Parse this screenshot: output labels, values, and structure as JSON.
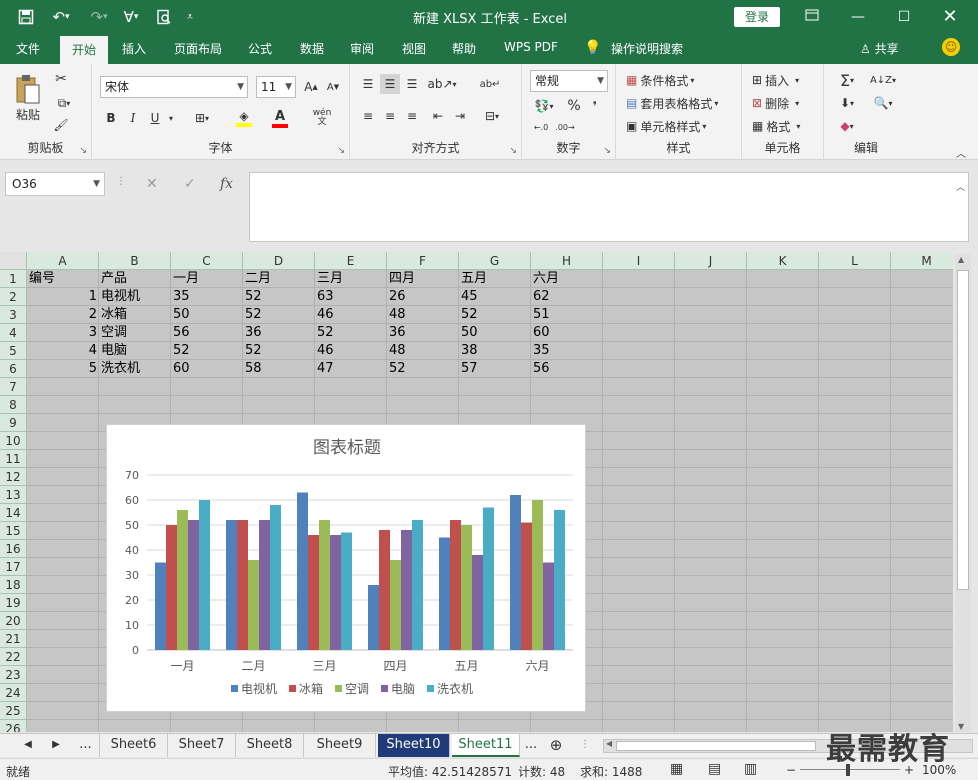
{
  "window": {
    "title": "新建 XLSX 工作表 - Excel",
    "login": "登录"
  },
  "tabs": [
    {
      "label": "文件"
    },
    {
      "label": "开始"
    },
    {
      "label": "插入"
    },
    {
      "label": "页面布局"
    },
    {
      "label": "公式"
    },
    {
      "label": "数据"
    },
    {
      "label": "审阅"
    },
    {
      "label": "视图"
    },
    {
      "label": "帮助"
    },
    {
      "label": "WPS PDF"
    },
    {
      "label": "操作说明搜索"
    }
  ],
  "share": "共享",
  "ribbon": {
    "clipboard": {
      "label": "剪贴板",
      "paste": "粘贴"
    },
    "font": {
      "label": "字体",
      "name": "宋体",
      "size": "11",
      "bold": "B",
      "italic": "I",
      "underline": "U",
      "wen": "wén"
    },
    "align": {
      "label": "对齐方式"
    },
    "number": {
      "label": "数字",
      "format": "常规",
      "percent": "%"
    },
    "styles": {
      "label": "样式",
      "cond": "条件格式",
      "table": "套用表格格式",
      "cell": "单元格样式"
    },
    "cells": {
      "label": "单元格",
      "insert": "插入",
      "delete": "删除",
      "format": "格式"
    },
    "edit": {
      "label": "编辑"
    }
  },
  "namebox": "O36",
  "columns": [
    "A",
    "B",
    "C",
    "D",
    "E",
    "F",
    "G",
    "H",
    "I",
    "J",
    "K",
    "L",
    "M"
  ],
  "rows": [
    "1",
    "2",
    "3",
    "4",
    "5",
    "6",
    "7",
    "8",
    "9",
    "10",
    "11",
    "12",
    "13",
    "14",
    "15",
    "16",
    "17",
    "18",
    "19",
    "20",
    "21",
    "22",
    "23",
    "24",
    "25",
    "26"
  ],
  "table": {
    "header": [
      "编号",
      "产品",
      "一月",
      "二月",
      "三月",
      "四月",
      "五月",
      "六月"
    ],
    "rows": [
      [
        "1",
        "电视机",
        "35",
        "52",
        "63",
        "26",
        "45",
        "62"
      ],
      [
        "2",
        "冰箱",
        "50",
        "52",
        "46",
        "48",
        "52",
        "51"
      ],
      [
        "3",
        "空调",
        "56",
        "36",
        "52",
        "36",
        "50",
        "60"
      ],
      [
        "4",
        "电脑",
        "52",
        "52",
        "46",
        "48",
        "38",
        "35"
      ],
      [
        "5",
        "洗衣机",
        "60",
        "58",
        "47",
        "52",
        "57",
        "56"
      ]
    ]
  },
  "chart_data": {
    "type": "bar",
    "title": "图表标题",
    "categories": [
      "一月",
      "二月",
      "三月",
      "四月",
      "五月",
      "六月"
    ],
    "series": [
      {
        "name": "电视机",
        "color": "#4f81bd",
        "values": [
          35,
          52,
          63,
          26,
          45,
          62
        ]
      },
      {
        "name": "冰箱",
        "color": "#c0504d",
        "values": [
          50,
          52,
          46,
          48,
          52,
          51
        ]
      },
      {
        "name": "空调",
        "color": "#9bbb59",
        "values": [
          56,
          36,
          52,
          36,
          50,
          60
        ]
      },
      {
        "name": "电脑",
        "color": "#8064a2",
        "values": [
          52,
          52,
          46,
          48,
          38,
          35
        ]
      },
      {
        "name": "洗衣机",
        "color": "#4bacc6",
        "values": [
          60,
          58,
          47,
          52,
          57,
          56
        ]
      }
    ],
    "yticks": [
      "0",
      "10",
      "20",
      "30",
      "40",
      "50",
      "60",
      "70"
    ],
    "ylim": [
      0,
      70
    ],
    "grid": true,
    "legend": "bottom"
  },
  "sheets": [
    {
      "label": "Sheet6"
    },
    {
      "label": "Sheet7"
    },
    {
      "label": "Sheet8"
    },
    {
      "label": "Sheet9"
    },
    {
      "label": "Sheet10"
    },
    {
      "label": "Sheet11"
    }
  ],
  "status": {
    "ready": "就绪",
    "average": "平均值: 42.51428571",
    "count": "计数: 48",
    "sum": "求和: 1488",
    "zoom": "100%"
  },
  "watermark": "最需教育",
  "colors": {
    "excel_green": "#217346",
    "selected_sheet": "#1f3b7a"
  }
}
